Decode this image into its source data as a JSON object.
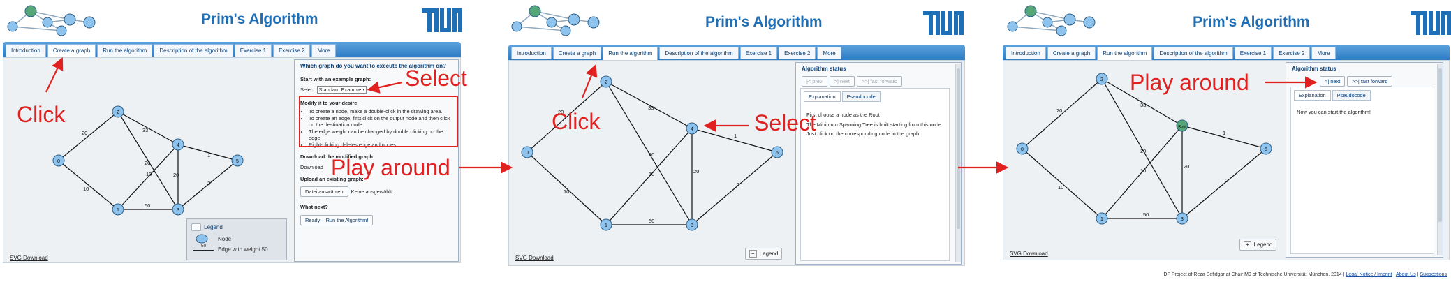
{
  "app_title": "Prim's Algorithm",
  "tabs": [
    "Introduction",
    "Create a graph",
    "Run the algorithm",
    "Description of the algorithm",
    "Exercise 1",
    "Exercise 2",
    "More"
  ],
  "graph": {
    "nodes": [
      "0",
      "1",
      "2",
      "3",
      "4",
      "5"
    ],
    "edge_weights": {
      "w02": "20",
      "w01": "10",
      "w13": "50",
      "w23": "33",
      "w24": "20",
      "w14": "10",
      "w34": "20",
      "w45": "1",
      "w35": "2"
    }
  },
  "svg_download": "SVG Download",
  "legend": {
    "title": "Legend",
    "node_label": "Node",
    "edge_weight_sample": "50",
    "edge_label": "Edge with weight 50",
    "button_label": "Legend",
    "minus_symbol": "–",
    "plus_symbol": "+"
  },
  "panel1": {
    "question": "Which graph do you want to execute the algorithm on?",
    "start_label": "Start with an example graph:",
    "select_label": "Select",
    "select_value": "Standard Example",
    "modify_title": "Modify it to your desire:",
    "modify_items": [
      "To create a node, make a double-click in the drawing area.",
      "To create an edge, first click on the output node and then click on the destination node.",
      "The edge weight can be changed by double clicking on the edge.",
      "Right-clicking deletes edge and nodes."
    ],
    "download_title": "Download the modified graph:",
    "download_link": "Download",
    "upload_title": "Upload an existing graph:",
    "file_button": "Datei auswählen",
    "file_status": "Keine ausgewählt",
    "next_title": "What next?",
    "run_button": "Ready – Run the Algorithm!"
  },
  "panel2": {
    "status_title": "Algorithm status",
    "prev_button": "|< prev",
    "next_button": ">| next",
    "ff_button": ">>| fast forward",
    "tab_explanation": "Explanation",
    "tab_pseudocode": "Pseudocode",
    "text_heading": "First choose a node as the Root",
    "text_line1": "The Minimum Spanning Tree is built starting from this node.",
    "text_line2": "Just click on the corresponding node in the graph."
  },
  "panel3": {
    "status_title": "Algorithm status",
    "next_button": ">| next",
    "ff_button": ">>| fast forward",
    "tab_explanation": "Explanation",
    "tab_pseudocode": "Pseudocode",
    "text": "Now you can start the algorithm!",
    "root_label": "Root"
  },
  "annotations": {
    "click": "Click",
    "select": "Select",
    "play_around": "Play around"
  },
  "footer": {
    "text": "IDP Project of Reza Sefidgar at Chair M9 of Technische Universität München. 2014 |",
    "legal": "Legal Notice / Imprint",
    "sep1": "|",
    "about": "About Us",
    "sep2": "|",
    "suggestions": "Suggestions"
  },
  "colors": {
    "brand_blue": "#1f6fb7",
    "node_fill": "#8ec3ee",
    "root_fill": "#56a777",
    "annotation_red": "#e0211f",
    "tab_bar": "#3a8ad0"
  }
}
